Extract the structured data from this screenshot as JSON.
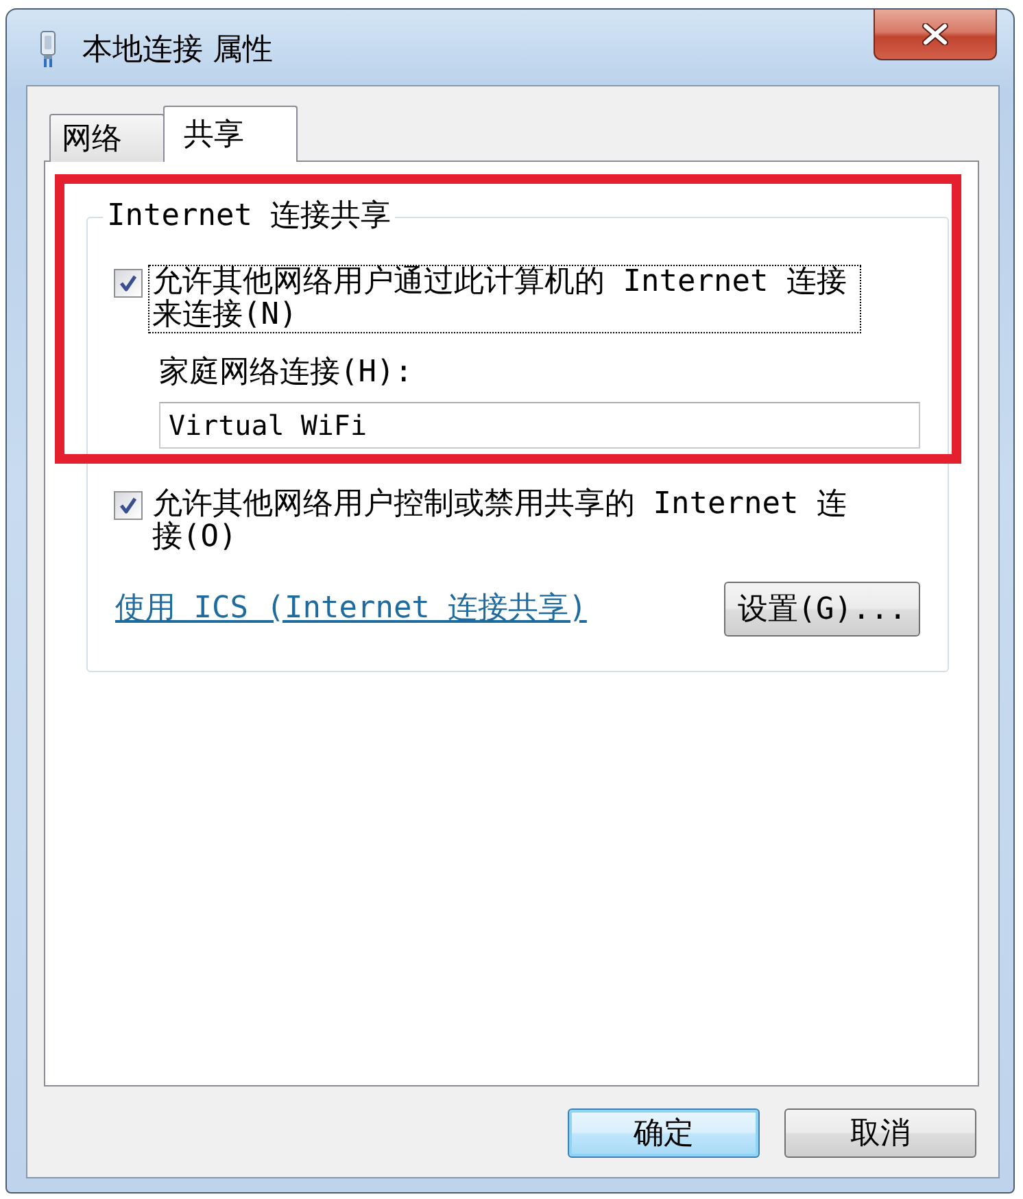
{
  "window": {
    "title": "本地连接 属性"
  },
  "tabs": [
    {
      "label": "网络",
      "selected": false
    },
    {
      "label": "共享",
      "selected": true
    }
  ],
  "sharing_group": {
    "title": "Internet 连接共享",
    "allow_sharing": {
      "label": "允许其他网络用户通过此计算机的 Internet 连接来连接(N)",
      "checked": true,
      "focused": true
    },
    "home_network": {
      "label": "家庭网络连接(H):",
      "value": "Virtual WiFi"
    },
    "allow_control": {
      "label": "允许其他网络用户控制或禁用共享的 Internet 连接(O)",
      "checked": true,
      "focused": false
    },
    "ics_link": "使用 ICS (Internet 连接共享)",
    "settings_button": "设置(G)..."
  },
  "annotation": {
    "kind": "rectangle"
  },
  "buttons": [
    {
      "label": "确定",
      "default": true
    },
    {
      "label": "取消",
      "default": false
    }
  ]
}
